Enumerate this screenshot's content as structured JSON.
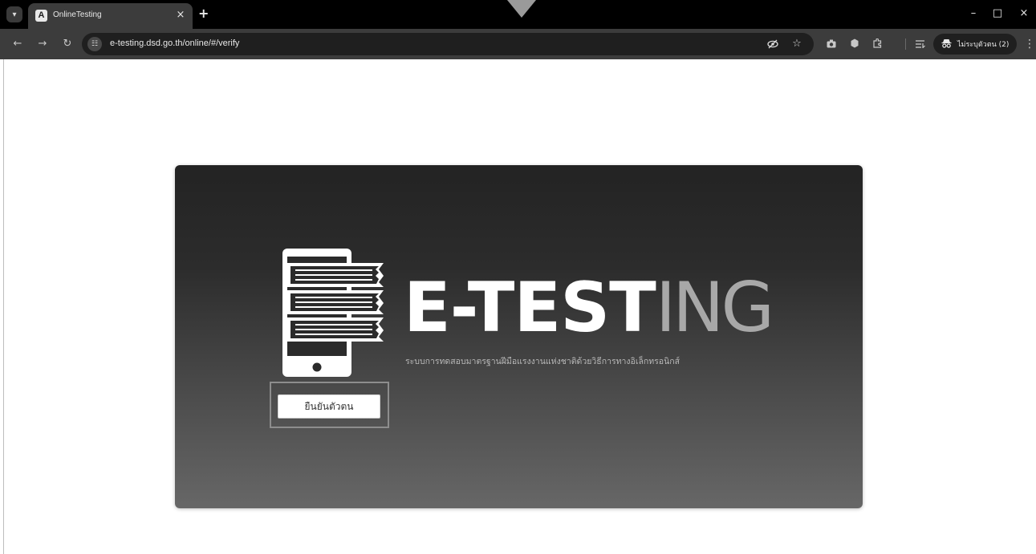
{
  "browser": {
    "tab": {
      "favicon_letter": "A",
      "title": "OnlineTesting",
      "close_glyph": "×"
    },
    "new_tab_glyph": "+",
    "window_controls": {
      "minimize": "–",
      "maximize": "□",
      "close": "×"
    },
    "toolbar": {
      "back_glyph": "←",
      "forward_glyph": "→",
      "reload_glyph": "↻",
      "url": "e-testing.dsd.go.th/online/#/verify",
      "profile_label": "ไม่ระบุตัวตน (2)"
    },
    "icons": [
      "chevron-down-icon",
      "site-info-icon",
      "eye-off-icon",
      "star-icon",
      "camera-icon",
      "extension-icon",
      "puzzle-icon",
      "reading-list-icon",
      "incognito-icon",
      "more-icon"
    ]
  },
  "page": {
    "brand": {
      "part_bold": "E-TEST",
      "part_light": "ING"
    },
    "tagline": "ระบบการทดสอบมาตรฐานฝีมือแรงงานแห่งชาติด้วยวิธีการทางอิเล็กทรอนิกส์",
    "verify_button": "ยืนยันตัวตน"
  },
  "colors": {
    "browser_frame": "#000000",
    "toolbar": "#3c3c3c",
    "card_top": "#232323",
    "card_bottom": "#676767",
    "brand_bold": "#ffffff",
    "brand_light": "#a8a8a8"
  }
}
